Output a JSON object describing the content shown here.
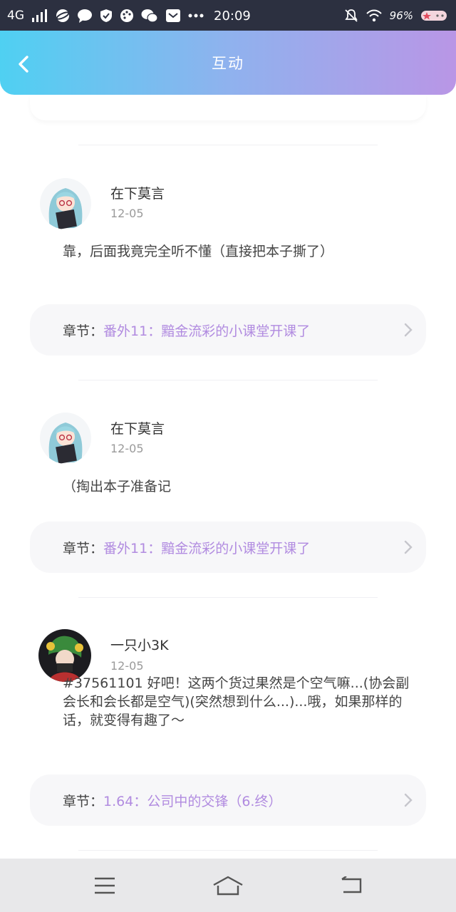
{
  "status_bar": {
    "network": "4G",
    "time": "20:09",
    "battery": "96%",
    "icons": [
      "signal-icon",
      "browser-icon",
      "message-icon",
      "shield-icon",
      "palette-icon",
      "wechat-icon",
      "mail-icon",
      "more-dots-icon",
      "mute-icon",
      "wifi-icon",
      "battery-sticker-icon"
    ]
  },
  "header": {
    "title": "互动",
    "back_icon": "chevron-left-icon",
    "gradient": [
      "#4fd0f2",
      "#b996e6"
    ]
  },
  "posts": [
    {
      "username": "在下莫言",
      "date": "12-05",
      "content": "靠，后面我竟完全听不懂（直接把本子撕了）",
      "chapter_label": "章节：",
      "chapter_title": "番外11：黯金流彩的小课堂开课了"
    },
    {
      "username": "在下莫言",
      "date": "12-05",
      "content": "（掏出本子准备记",
      "chapter_label": "章节：",
      "chapter_title": "番外11：黯金流彩的小课堂开课了"
    },
    {
      "username": "一只小3K",
      "date": "12-05",
      "content": "#37561101 好吧！这两个货过果然是个空气嘛...(协会副会长和会长都是空气)(突然想到什么...)...哦，如果那样的话，就变得有趣了～",
      "chapter_label": "章节：",
      "chapter_title": "1.64：公司中的交锋（6.终）"
    }
  ],
  "colors": {
    "accent_purple": "#b18be0",
    "chapter_bg": "#f7f7f9",
    "navbar_bg": "#e8e8ea"
  },
  "nav": {
    "icons": [
      "menu-icon",
      "home-icon",
      "back-icon"
    ]
  }
}
